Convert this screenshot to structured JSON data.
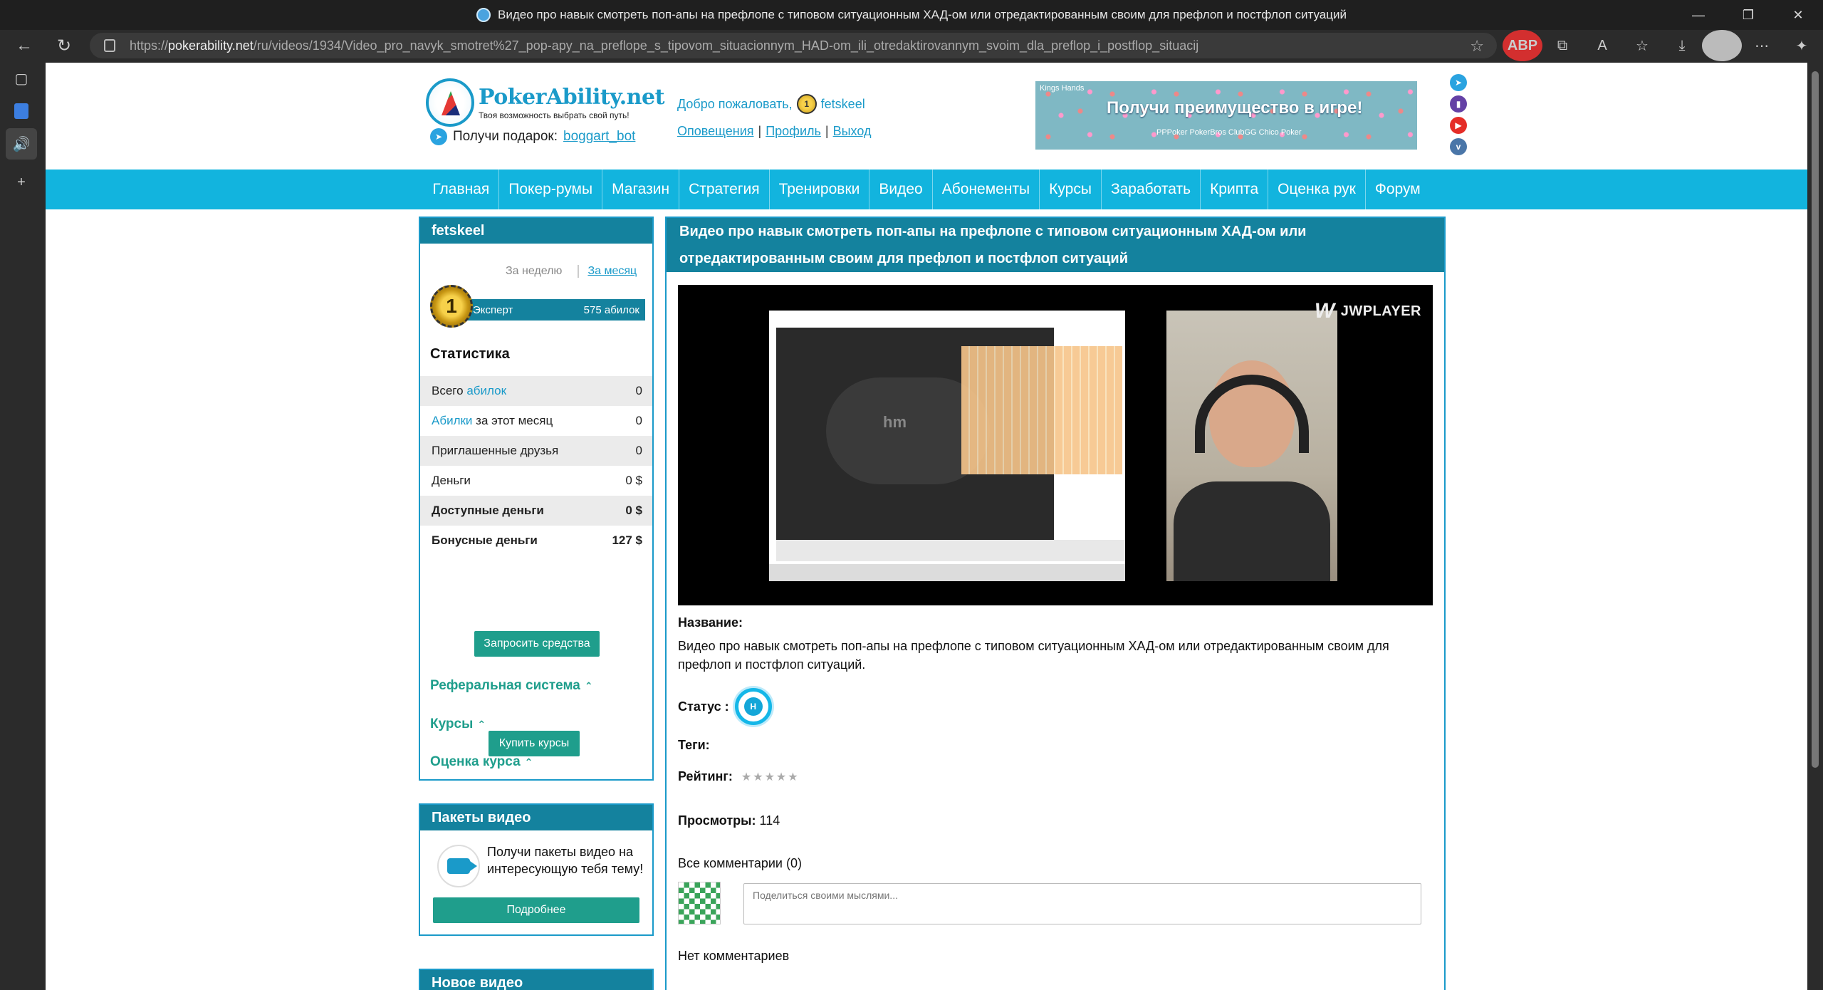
{
  "browser": {
    "tab_title": "Видео про навык смотреть поп-апы на префлопе с типовом ситуационным ХАД-ом или отредактированным своим для префлоп и постфлоп ситуаций",
    "url_prefix": "https://",
    "url_host": "pokerability.net",
    "url_path": "/ru/videos/1934/Video_pro_navyk_smotret%27_pop-apy_na_preflope_s_tipovom_situacionnym_HAD-om_ili_otredaktirovannym_svoim_dla_preflop_i_postflop_situacij",
    "extension_abp_label": "ABP"
  },
  "header": {
    "logo_title": "PokerAbility.net",
    "logo_subtitle": "Твоя возможность выбрать свой путь!",
    "gift_text": "Получи подарок:",
    "gift_link": "boggart_bot",
    "welcome_text": "Добро пожаловать,",
    "username": "fetskeel",
    "links": [
      "Оповещения",
      "Профиль",
      "Выход"
    ],
    "banner_text": "Получи преимущество в игре!",
    "banner_small": "PPPoker PokerBros ClubGG Chico Poker",
    "banner_brand": "Kings Hands"
  },
  "nav": [
    "Главная",
    "Покер-румы",
    "Магазин",
    "Стратегия",
    "Тренировки",
    "Видео",
    "Абонементы",
    "Курсы",
    "Заработать",
    "Крипта",
    "Оценка рук",
    "Форум"
  ],
  "userbox": {
    "title": "fetskeel",
    "period_week": "За неделю",
    "period_month": "За месяц",
    "medal_number": "1",
    "level": "Эксперт",
    "points": "575 абилок",
    "stats_title": "Статистика",
    "stats": [
      {
        "pre": "Всего ",
        "link": "абилок",
        "post": "",
        "value": "0"
      },
      {
        "pre": "",
        "link": "Абилки",
        "post": " за этот месяц",
        "value": "0"
      },
      {
        "pre": "Приглашенные друзья",
        "link": "",
        "post": "",
        "value": "0"
      },
      {
        "pre": "Деньги",
        "link": "",
        "post": "",
        "value": "0 $"
      },
      {
        "pre": "Доступные деньги",
        "link": "",
        "post": "",
        "value": "0 $"
      },
      {
        "pre": "Бонусные деньги",
        "link": "",
        "post": "",
        "value": "127 $"
      }
    ],
    "request_button": "Запросить средства",
    "referral": "Реферальная система",
    "courses": "Курсы",
    "course_rating": "Оценка курса",
    "buy_button": "Купить курсы"
  },
  "packs": {
    "title": "Пакеты видео",
    "text": "Получи пакеты видео на интересующую тебя тему!",
    "button": "Подробнее"
  },
  "new_video": {
    "title": "Новое видео"
  },
  "video": {
    "title": "Видео про навык смотреть поп-апы на префлопе с типовом ситуационным ХАД-ом или отредактированным своим для префлоп и постфлоп ситуаций",
    "player_brand": "JWPLAYER",
    "name_label": "Название:",
    "name_value": "Видео про навык смотреть поп-апы на префлопе с типовом ситуационным ХАД-ом или отредактированным своим для префлоп и постфлоп ситуаций.",
    "status_label": "Статус :",
    "status_badge": "H",
    "tags_label": "Теги:",
    "rating_label": "Рейтинг:",
    "rating_stars": "★★★★★",
    "views_label": "Просмотры:",
    "views_value": "114",
    "all_comments": "Все комментарии (0)",
    "comment_placeholder": "Поделиться своими мыслями...",
    "no_comments": "Нет комментариев"
  }
}
